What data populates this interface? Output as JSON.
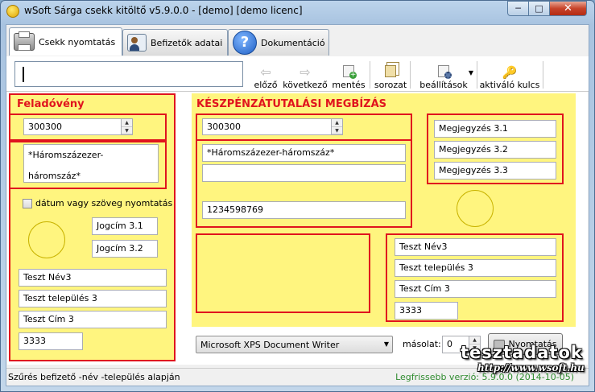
{
  "window": {
    "title": "wSoft Sárga csekk kitöltő v5.9.0.0 - [demo] [demo licenc]"
  },
  "tabs": [
    {
      "label": "Csekk nyomtatás",
      "icon": "printer-icon"
    },
    {
      "label": "Befizetők adatai",
      "icon": "person-card-icon"
    },
    {
      "label": "Dokumentáció",
      "icon": "help-icon"
    }
  ],
  "toolbar": {
    "prev_label": "előző",
    "next_label": "következő",
    "save_label": "mentés",
    "series_label": "sorozat",
    "settings_label": "beállítások",
    "activation_label": "aktiváló kulcs"
  },
  "left_panel": {
    "header": "Feladóvény",
    "amount": "300300",
    "amount_words_1": "*Háromszázezer-",
    "amount_words_2": "háromszáz*",
    "date_checkbox_label": "dátum vagy szöveg nyomtatás",
    "jogcim_1": "Jogcím 3.1",
    "jogcim_2": "Jogcím 3.2",
    "name": "Teszt Név3",
    "city": "Teszt település 3",
    "address": "Teszt Cím 3",
    "zip": "3333"
  },
  "right_panel": {
    "header": "KÉSZPÉNZÁTUTALÁSI MEGBÍZÁS",
    "amount": "300300",
    "amount_words": "*Háromszázezer-háromszáz*",
    "amount_words_2": "",
    "account": "1234598769",
    "notes": [
      "Megjegyzés 3.1",
      "Megjegyzés 3.2",
      "Megjegyzés 3.3"
    ],
    "name": "Teszt Név3",
    "city": "Teszt település 3",
    "address": "Teszt Cím 3",
    "zip": "3333"
  },
  "print": {
    "printer": "Microsoft XPS Document Writer",
    "copies_label": "másolat:",
    "copies": "0",
    "print_button": "Nyomtatás"
  },
  "status": {
    "left": "Szűrés befizető -név -település alapján",
    "right": "Legfrissebb verzió: 5.9.0.0 (2014-10-05)"
  },
  "watermark": {
    "brand": "tesztadatok",
    "url": "http://www.wsoft.hu"
  },
  "colors": {
    "form_yellow": "#fff57f",
    "frame_red": "#e0141e",
    "status_green": "#2e8b2e"
  }
}
